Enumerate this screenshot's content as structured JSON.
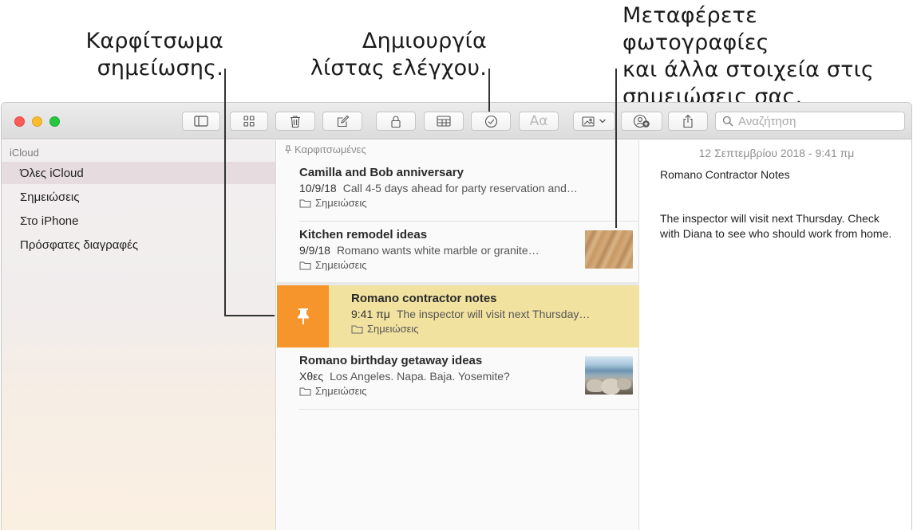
{
  "callouts": {
    "pin": [
      "Καρφίτσωμα",
      "σημείωσης."
    ],
    "checklist": [
      "Δημιουργία",
      "λίστας ελέγχου."
    ],
    "drag": [
      "Μεταφέρετε φωτογραφίες",
      "και άλλα στοιχεία στις",
      "σημειώσεις σας."
    ]
  },
  "toolbar": {
    "buttons": [
      "sidebar-toggle",
      "gallery-view",
      "delete",
      "compose",
      "lock",
      "table",
      "checklist",
      "format",
      "media",
      "collaborate",
      "share"
    ],
    "format_label": "Aα",
    "search_placeholder": "Αναζήτηση"
  },
  "sidebar": {
    "section": "iCloud",
    "items": [
      {
        "label": "Όλες iCloud",
        "selected": true
      },
      {
        "label": "Σημειώσεις",
        "selected": false
      },
      {
        "label": "Στο iPhone",
        "selected": false
      },
      {
        "label": "Πρόσφατες διαγραφές",
        "selected": false
      }
    ]
  },
  "notes": {
    "pinned_header": "Καρφιτσωμένες",
    "items": [
      {
        "title": "Camilla and Bob anniversary",
        "date": "10/9/18",
        "preview": "Call 4-5 days ahead for party reservation and…",
        "folder": "Σημειώσεις",
        "thumbnail": ""
      },
      {
        "title": "Kitchen remodel ideas",
        "date": "9/9/18",
        "preview": "Romano wants white marble or granite…",
        "folder": "Σημειώσεις",
        "thumbnail": "wood"
      },
      {
        "title": "Romano contractor notes",
        "date": "9:41 πμ",
        "preview": "The inspector will visit next Thursday…",
        "folder": "Σημειώσεις",
        "thumbnail": "",
        "selected": true
      },
      {
        "title": "Romano birthday getaway ideas",
        "date": "Χθες",
        "preview": "Los Angeles. Napa. Baja. Yosemite?",
        "folder": "Σημειώσεις",
        "thumbnail": "beach"
      }
    ]
  },
  "editor": {
    "date": "12 Σεπτεμβρίου 2018 - 9:41 πμ",
    "title": "Romano Contractor Notes",
    "body": "The inspector will visit next Thursday. Check with Diana to see who should work from home."
  },
  "colors": {
    "selected_note": "#f2e2a0",
    "pin_action": "#f7952d",
    "sidebar_selected": "#e6dbde"
  }
}
